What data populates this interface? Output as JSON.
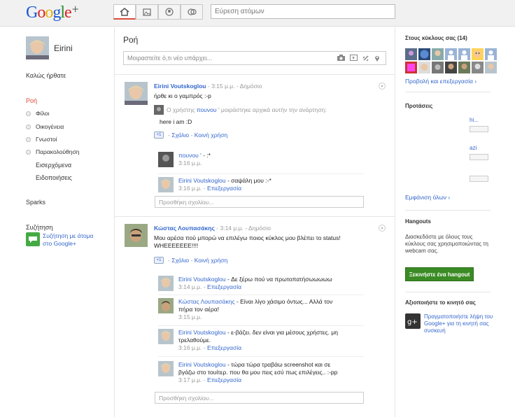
{
  "header": {
    "logo_word": "Google",
    "logo_plus": "+",
    "nav": [
      "home-icon",
      "photos-icon",
      "profile-icon",
      "circles-icon"
    ],
    "search_placeholder": "Εύρεση ατόμων"
  },
  "left": {
    "user_name": "Eirini",
    "welcome": "Καλώς ήρθατε",
    "stream": "Ροή",
    "circles": [
      "Φίλοι",
      "Οικογένεια",
      "Γνωστοί",
      "Παρακολούθηση"
    ],
    "incoming": "Εισερχόμενα",
    "notifications": "Ειδοποιήσεις",
    "sparks": "Sparks",
    "chat_title": "Συζήτηση",
    "chat_link_1": "Συζήτηση με άτομα",
    "chat_link_2": "στο Google+"
  },
  "main": {
    "title": "Ροή",
    "share_placeholder": "Μοιραστείτε ό,τι νέο υπάρχει...",
    "comment_placeholder": "Προσθήκη σχολίου...",
    "comment_label": "Σχόλιο",
    "share_label": "Κοινή χρήση",
    "dash": "-",
    "post1": {
      "author": "Eirini Voutskoglou",
      "time": "3:15 μ.μ.",
      "visibility": "Δημόσιο",
      "text": "ήρθε κι ο γαμπρός :-p",
      "reshare_prefix": "Ο χρήστης",
      "reshare_user": "πουνου",
      "reshare_suffix": "' μοιράστηκε αρχικά αυτήν την ανάρτηση:",
      "reshare_text": "here i am :D",
      "comments": [
        {
          "author": "πουνου '",
          "text": "- :*",
          "meta": "3:16 μ.μ.",
          "edit": ""
        },
        {
          "author": "Eirini Voutskoglou",
          "text": "- σαψάλη μου :-*",
          "meta": "3:16 μ.μ.",
          "edit": "Επεξεργασία"
        }
      ]
    },
    "post2": {
      "author": "Κώστας Λουπασάκης",
      "time": "3:14 μ.μ.",
      "visibility": "Δημόσιο",
      "text": "Μου αρέσα πού μπορώ να επιλέγω ποιος κύκλος μου βλέπει το status! WHEEEEEEE!!!!",
      "comments": [
        {
          "author": "Eirini Voutskoglou",
          "text": "- Δε ξέρω πού να πρωτοπατήσωωωωω",
          "text2": "",
          "meta": "3:14 μ.μ.",
          "edit": "Επεξεργασία"
        },
        {
          "author": "Κώστας Λουπασάκης",
          "text": "- Είναι λίγο χάσιμο όντως... Αλλά τον",
          "text2": "πήρα τον αέρα!",
          "meta": "3:15 μ.μ.",
          "edit": ""
        },
        {
          "author": "Eirini Voutskoglou",
          "text": "- ε-βάζει. δεν είναι για μέσους χρήστες. μη",
          "text2": "τρελαθούμε.",
          "meta": "3:16 μ.μ.",
          "edit": "Επεξεργασία"
        },
        {
          "author": "Eirini Voutskoglou",
          "text": "- τώρα τώρα τραβάω screenshot και σε",
          "text2": "βγάζω στο τουίτερ. που θα μου πεις εσύ πως επιλέγεις.. :-pp",
          "meta": "3:17 μ.μ.",
          "edit": "Επεξεργασία"
        }
      ]
    }
  },
  "right": {
    "circles_title": "Στους κύκλους σας (14)",
    "view_edit": "Προβολή και επεξεργασία ›",
    "suggestions_title": "Προτάσεις",
    "sugg": [
      "hi...",
      "azi",
      ""
    ],
    "show_all": "Εμφάνιση όλων ›",
    "hangouts_title": "Hangouts",
    "hangouts_text": "Διασκεδάστε με όλους τους κύκλους σας χρησιμοποιώντας τη webcam σας.",
    "hangout_button": "Ξεκινήστε ένα hangout",
    "mobile_title": "Αξιοποιήστε το κινητό σας",
    "mobile_text": "Πραγματοποιήστε λήψη του Google+ για τη κινητή σας συσκευή"
  },
  "colors": {
    "accent": "#dd4b39",
    "link": "#3366cc",
    "hangout": "#3a8b24"
  }
}
